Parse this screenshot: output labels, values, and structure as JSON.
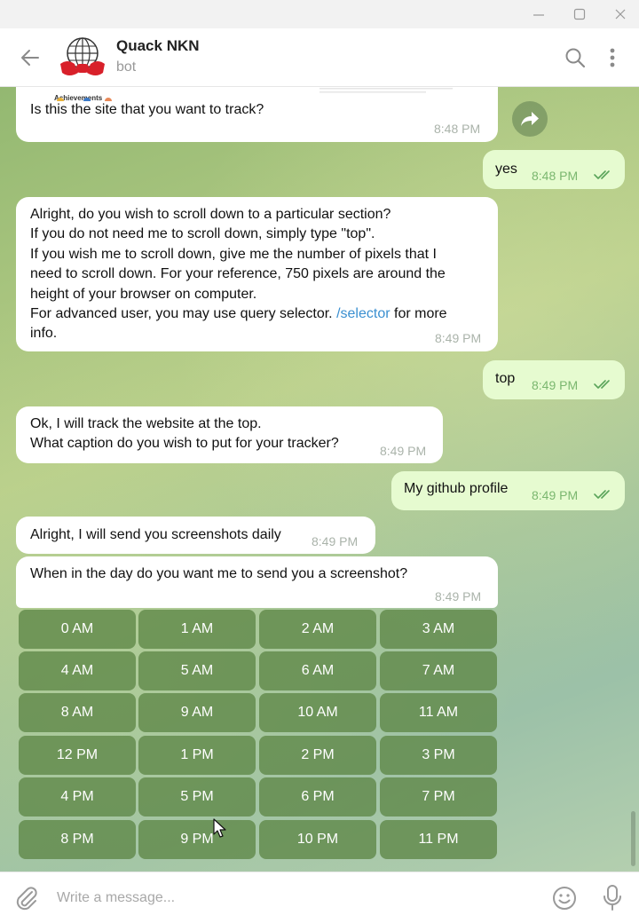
{
  "window": {
    "controls": [
      "minimize-icon",
      "maximize-icon",
      "close-icon"
    ]
  },
  "header": {
    "title": "Quack NKN",
    "subtitle": "bot",
    "icons": [
      "back-arrow-icon",
      "search-icon",
      "more-vertical-icon"
    ]
  },
  "messages": {
    "preview": {
      "heading": "Achievements",
      "text": "Is this the site that you want to track?",
      "time": "8:48 PM"
    },
    "yes": {
      "text": "yes",
      "time": "8:48 PM"
    },
    "scroll_question": {
      "text": "Alright, do you wish to scroll down to a particular section?\nIf you do not need me to scroll down, simply type \"top\".\nIf you wish me to scroll down, give me the number of pixels that I\nneed to scroll down. For your reference, 750 pixels are around the\nheight of your browser on computer.\nFor advanced user, you may use query selector.",
      "link": "/selector",
      "text_after": "for more\ninfo.",
      "time": "8:49 PM"
    },
    "top": {
      "text": "top",
      "time": "8:49 PM"
    },
    "caption_question": {
      "text": "Ok, I will track the website at the top.\nWhat caption do you wish to put for your tracker?",
      "time": "8:49 PM"
    },
    "caption_answer": {
      "text": "My github profile",
      "time": "8:49 PM"
    },
    "daily": {
      "text": "Alright, I will send you screenshots daily",
      "time": "8:49 PM"
    },
    "when": {
      "text": "When in the day do you want me to send you a screenshot?",
      "time": "8:49 PM"
    }
  },
  "keyboard": {
    "buttons": [
      [
        "0 AM",
        "1 AM",
        "2 AM",
        "3 AM"
      ],
      [
        "4 AM",
        "5 AM",
        "6 AM",
        "7 AM"
      ],
      [
        "8 AM",
        "9 AM",
        "10 AM",
        "11 AM"
      ],
      [
        "12 PM",
        "1 PM",
        "2 PM",
        "3 PM"
      ],
      [
        "4 PM",
        "5 PM",
        "6 PM",
        "7 PM"
      ],
      [
        "8 PM",
        "9 PM",
        "10 PM",
        "11 PM"
      ]
    ]
  },
  "composer": {
    "placeholder": "Write a message...",
    "icons": [
      "paperclip-icon",
      "emoji-icon",
      "microphone-icon"
    ]
  },
  "colors": {
    "link": "#3a8fd0",
    "outgoing_bubble": "#e6fbd0",
    "check": "#5aa45a",
    "keyboard_button": "#5d8746"
  }
}
